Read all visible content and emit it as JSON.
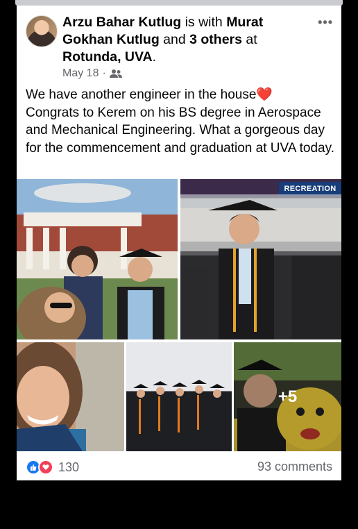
{
  "post": {
    "author": "Arzu Bahar Kutlug",
    "with_text": " is with ",
    "tagged_friend": "Murat Gokhan Kutlug",
    "and_text": " and ",
    "others": "3 others",
    "at_text": " at ",
    "location": "Rotunda, UVA",
    "period": ".",
    "date": "May 18",
    "separator": "·",
    "audience_icon": "friends-icon",
    "more_icon": "•••",
    "text_line1": "We have another engineer in the house",
    "heart": "❤️",
    "text_rest": "Congrats to Kerem on his BS degree in Aerospace and Mechanical  Engineering. What a gorgeous day for the commencement and graduation at UVA today."
  },
  "photos": {
    "sign_text": "RECREATION",
    "more_count": "+5"
  },
  "footer": {
    "reaction_count": "130",
    "comments": "93 comments"
  },
  "colors": {
    "like_blue": "#1877f2",
    "love_red": "#f33e58",
    "secondary_text": "#65676b"
  }
}
